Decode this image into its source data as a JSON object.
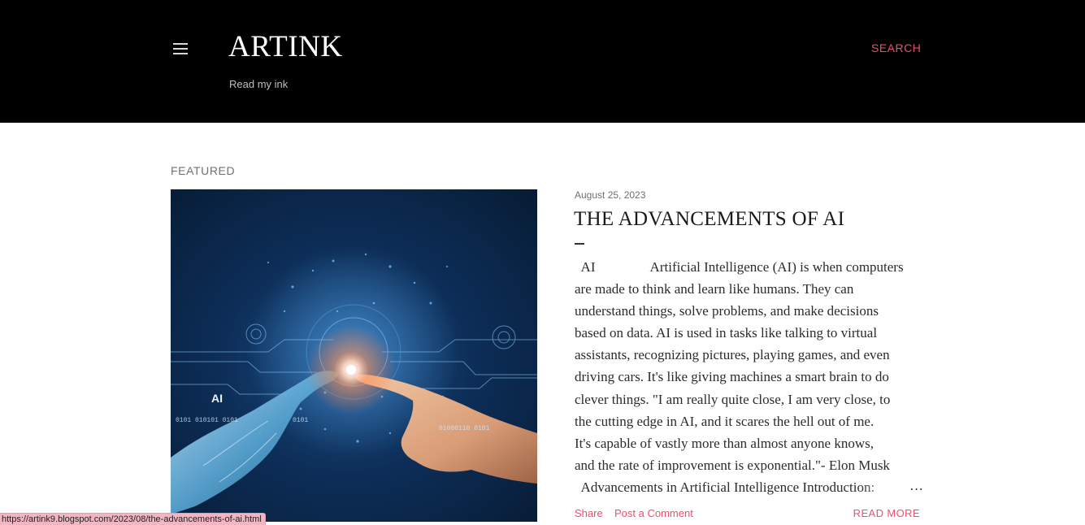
{
  "header": {
    "title": "ARTINK",
    "description": "Read my ink",
    "search_label": "SEARCH",
    "menu_icon": "hamburger-menu-icon"
  },
  "featured": {
    "section_label": "FEATURED",
    "image": {
      "icon": "ai-robot-human-hand-illustration",
      "overlay_text": "AI"
    },
    "post": {
      "date": "August 25, 2023",
      "title": "THE ADVANCEMENTS OF AI",
      "snippet_lines": [
        "  AI                Artificial Intelligence (AI) is when computers",
        "are made to think and learn like humans. They can",
        "understand things, solve problems, and make decisions",
        "based on data. AI is used in tasks like talking to virtual",
        "assistants, recognizing pictures, playing games, and even",
        "driving cars. It's like giving machines a smart brain to do",
        "clever things. \"I am really quite close, I am very close, to",
        "the cutting edge in AI, and it scares the hell out of me.",
        "It's capable of vastly more than almost anyone knows,",
        "and the rate of improvement is exponential.\"- Elon Musk",
        "  Advancements in Artificial Intelligence Introduction:"
      ],
      "ellipsis": "…",
      "share_label": "Share",
      "comment_label": "Post a Comment",
      "read_more_label": "READ MORE"
    }
  },
  "status_bar": {
    "url": "https://artink9.blogspot.com/2023/08/the-advancements-of-ai.html"
  },
  "colors": {
    "header_bg": "#000000",
    "accent": "#f04c70",
    "status_bar_bg": "#f3b5c3"
  }
}
